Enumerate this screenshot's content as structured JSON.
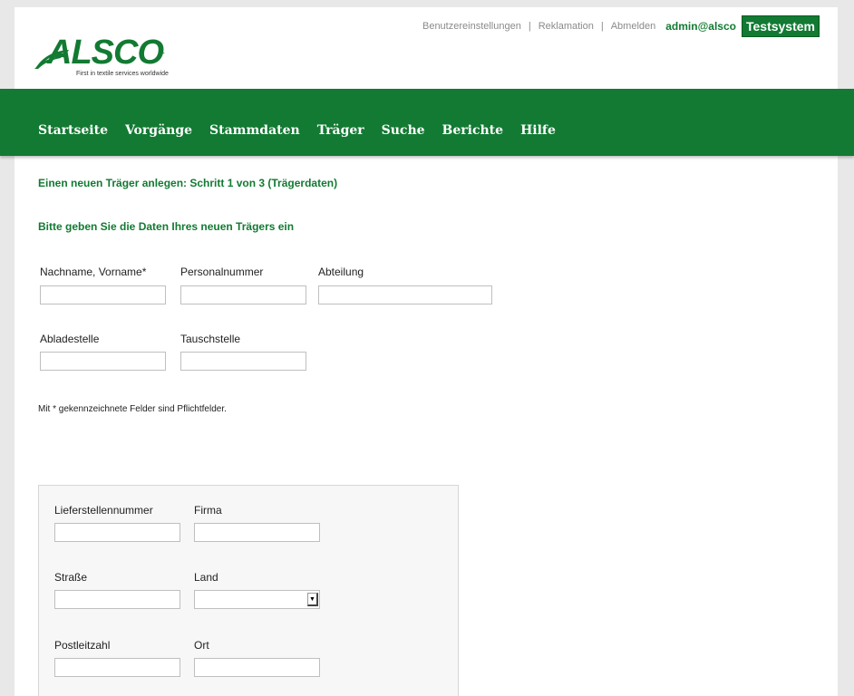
{
  "brand": {
    "logo_text": "ALSCO",
    "logo_reg": ".",
    "tagline": "First in textile services worldwide",
    "color": "#127a32"
  },
  "toplinks": {
    "settings": "Benutzereinstellungen",
    "complaint": "Reklamation",
    "logout": "Abmelden",
    "separator": "|",
    "user": "admin@alsco",
    "badge": "Testsystem"
  },
  "nav": [
    "Startseite",
    "Vorgänge",
    "Stammdaten",
    "Träger",
    "Suche",
    "Berichte",
    "Hilfe"
  ],
  "headings": {
    "step": "Einen neuen Träger anlegen: Schritt 1 von 3 (Trägerdaten)",
    "sub": "Bitte geben Sie die Daten Ihres neuen Trägers ein"
  },
  "fields": {
    "name": "Nachname, Vorname*",
    "personnel": "Personalnummer",
    "department": "Abteilung",
    "unloading": "Abladestelle",
    "exchange": "Tauschstelle"
  },
  "note": "Mit * gekennzeichnete Felder sind Pflichtfelder.",
  "delivery": {
    "number": "Lieferstellennummer",
    "company": "Firma",
    "street": "Straße",
    "country": "Land",
    "country_value": "",
    "zip": "Postleitzahl",
    "city": "Ort"
  }
}
